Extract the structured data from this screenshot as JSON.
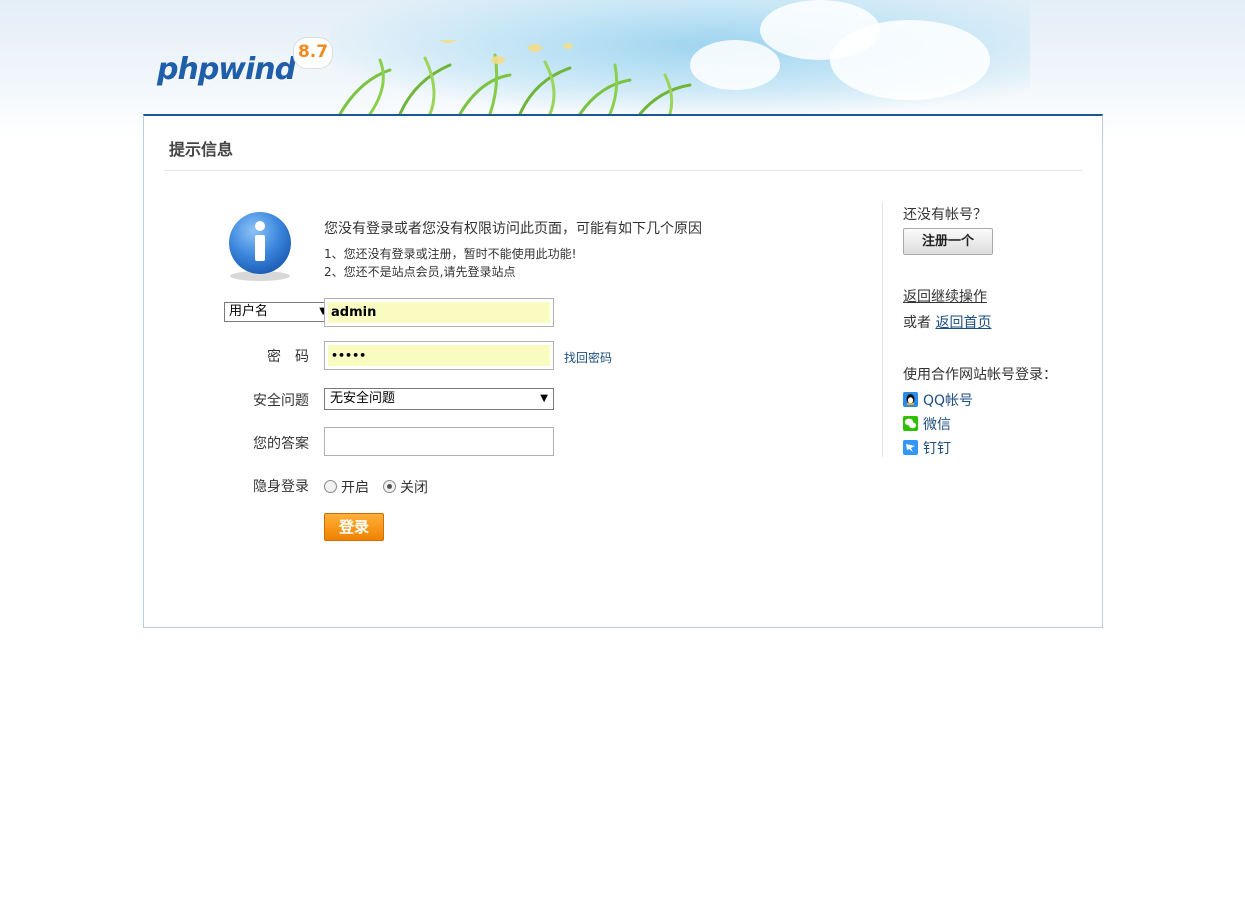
{
  "header": {
    "logo_text": "phpwind",
    "logo_version": "8.7"
  },
  "panel": {
    "title": "提示信息"
  },
  "message": {
    "main": "您没有登录或者您没有权限访问此页面，可能有如下几个原因",
    "reasons": [
      "1、您还没有登录或注册，暂时不能使用此功能!",
      "2、您还不是站点会员,请先登录站点"
    ]
  },
  "form": {
    "username_type": "用户名",
    "username_value": "admin",
    "password_label": "密　码",
    "password_value": "•••••",
    "find_password": "找回密码",
    "question_label": "安全问题",
    "question_value": "无安全问题",
    "answer_label": "您的答案",
    "answer_value": "",
    "hidden_label": "隐身登录",
    "hidden_options": [
      "开启",
      "关闭"
    ],
    "hidden_selected": "关闭",
    "login_button": "登录"
  },
  "sidebar": {
    "no_account": "还没有帐号？",
    "register_button": "注册一个",
    "back_continue": "返回继续操作",
    "or_text": "或者",
    "back_home": "返回首页",
    "partner_title": "使用合作网站帐号登录：",
    "partners": [
      {
        "label": "QQ帐号",
        "icon": "qq-icon",
        "color": "#2a8ce6"
      },
      {
        "label": "微信",
        "icon": "wechat-icon",
        "color": "#2dc100"
      },
      {
        "label": "钉钉",
        "icon": "dingtalk-icon",
        "color": "#3296fa"
      }
    ]
  },
  "colors": {
    "accent_blue": "#1a5891",
    "link": "#1d4e80",
    "login_orange": "#f08200",
    "autofill_yellow": "#fafbc1"
  }
}
